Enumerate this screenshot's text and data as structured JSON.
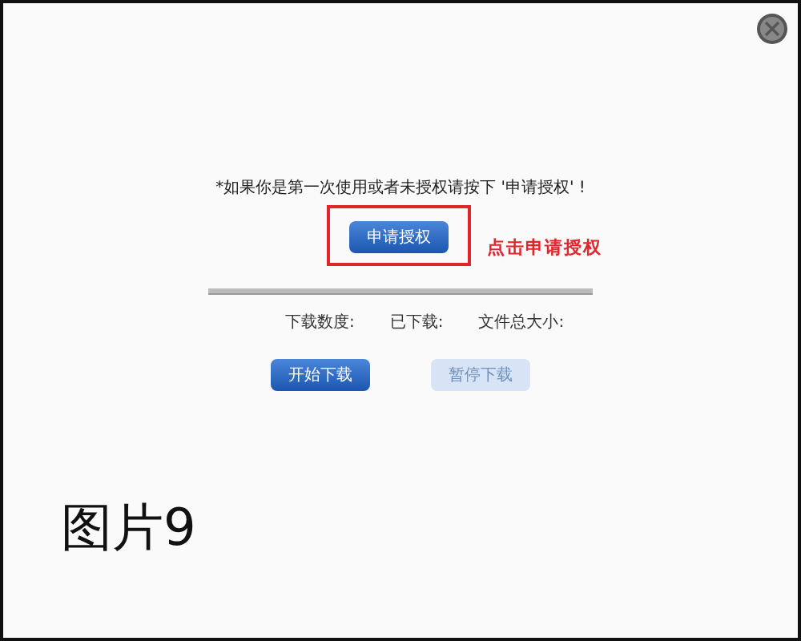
{
  "dialog": {
    "notice": "*如果你是第一次使用或者未授权请按下 '申请授权' !",
    "request_button": {
      "label": "申请授权",
      "highlighted": true
    },
    "annotation": "点击申请授权",
    "progress": {
      "level": 0
    },
    "stats": [
      {
        "label": "下载数度:"
      },
      {
        "label": "已下载:"
      },
      {
        "label": "文件总大小:"
      }
    ],
    "buttons": [
      {
        "label": "开始下载",
        "disabled": false
      },
      {
        "label": "暂停下载",
        "disabled": true
      }
    ]
  },
  "caption": "图片9"
}
